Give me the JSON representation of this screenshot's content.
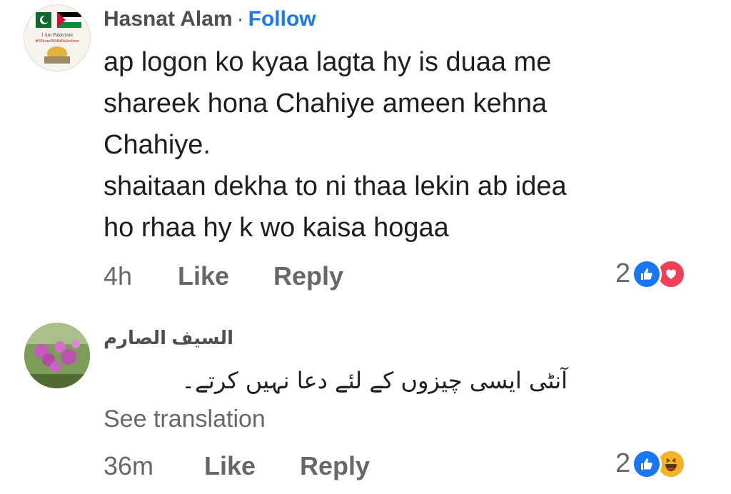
{
  "comments": [
    {
      "author": "Hasnat Alam",
      "separator": "·",
      "follow_label": "Follow",
      "avatar_text_line1": "I Am Pakistani",
      "avatar_text_line2": "#IStandWithPalestine",
      "lines": [
        "ap logon ko kyaa lagta hy is duaa me",
        "shareek hona Chahiye ameen kehna",
        "Chahiye.",
        "shaitaan dekha to ni thaa lekin ab idea",
        "ho rhaa hy k wo kaisa hogaa"
      ],
      "time": "4h",
      "like_label": "Like",
      "reply_label": "Reply",
      "reaction_count": "2",
      "reactions": [
        "like-icon",
        "love-icon"
      ]
    },
    {
      "author": "السيف الصارم",
      "text": "آنٹی ایسی چیزوں کے لئے دعا نہیں کرتے۔",
      "translation_label": "See translation",
      "time": "36m",
      "like_label": "Like",
      "reply_label": "Reply",
      "reaction_count": "2",
      "reactions": [
        "like-icon",
        "haha-icon"
      ]
    }
  ],
  "colors": {
    "link": "#1877f2",
    "meta": "#65676b",
    "text": "#1c1e21",
    "love": "#f33e58",
    "haha": "#f7b125"
  }
}
